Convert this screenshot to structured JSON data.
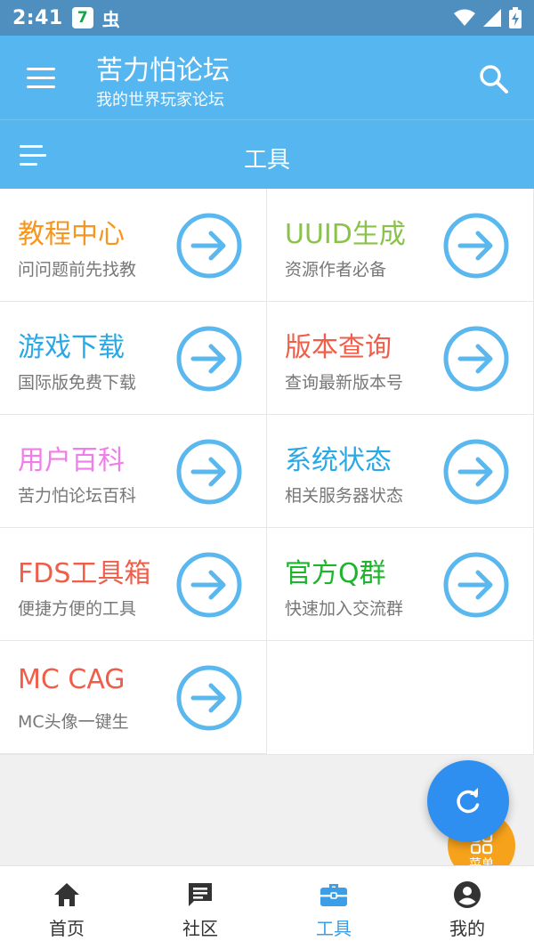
{
  "status_bar": {
    "time": "2:41",
    "app_badge": "7",
    "bug_glyph": "虫"
  },
  "app_bar": {
    "title": "苦力怕论坛",
    "subtitle": "我的世界玩家论坛"
  },
  "sub_bar": {
    "title": "工具"
  },
  "tools": [
    {
      "title": "教程中心",
      "desc": "问问题前先找教",
      "color": "#f7961f"
    },
    {
      "title": "UUID生成",
      "desc": "资源作者必备",
      "color": "#8bc34a"
    },
    {
      "title": "游戏下载",
      "desc": "国际版免费下载",
      "color": "#29a8e6"
    },
    {
      "title": "版本查询",
      "desc": "查询最新版本号",
      "color": "#f05d48"
    },
    {
      "title": "用户百科",
      "desc": "苦力怕论坛百科",
      "color": "#f07ee8"
    },
    {
      "title": "系统状态",
      "desc": "相关服务器状态",
      "color": "#29a8e6"
    },
    {
      "title": "FDS工具箱",
      "desc": "便捷方便的工具",
      "color": "#f05d48"
    },
    {
      "title": "官方Q群",
      "desc": "快速加入交流群",
      "color": "#1cb52b"
    },
    {
      "title": "MC CAG",
      "desc": "MC头像一键生",
      "color": "#f05d48"
    }
  ],
  "float_menu": {
    "label": "菜单"
  },
  "bottom_nav": [
    {
      "label": "首页",
      "icon": "home-icon",
      "active": false
    },
    {
      "label": "社区",
      "icon": "chat-icon",
      "active": false
    },
    {
      "label": "工具",
      "icon": "toolbox-icon",
      "active": true
    },
    {
      "label": "我的",
      "icon": "account-icon",
      "active": false
    }
  ],
  "colors": {
    "primary": "#55b6f0",
    "accent_arrow": "#5ab8ee",
    "fab": "#2f8ff0",
    "menu_float": "#f7a21b"
  }
}
